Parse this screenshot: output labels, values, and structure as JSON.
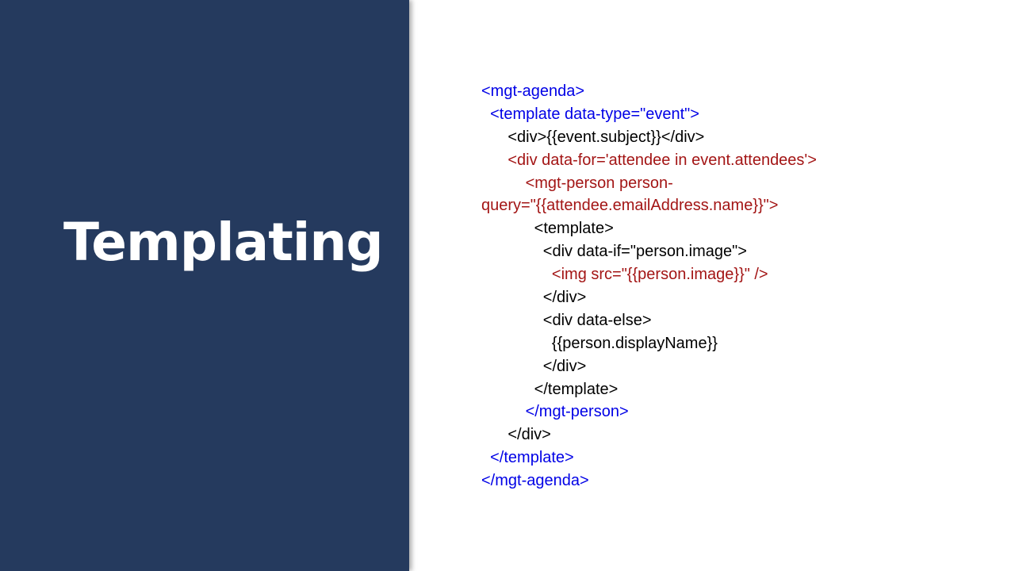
{
  "slide": {
    "title": "Templating",
    "colors": {
      "panel_background": "#253a5e",
      "title_text": "#ffffff",
      "code_blue": "#0000e6",
      "code_red": "#a31515",
      "code_black": "#000000"
    },
    "code_lines": [
      {
        "text": "<mgt-agenda>",
        "color": "blue"
      },
      {
        "text": "  <template data-type=\"event\">",
        "color": "blue"
      },
      {
        "text": "      <div>{{event.subject}}</div>",
        "color": "black"
      },
      {
        "text": "      <div data-for='attendee in event.attendees'>",
        "color": "red"
      },
      {
        "text": "          <mgt-person person-",
        "color": "red"
      },
      {
        "text": "query=\"{{attendee.emailAddress.name}}\">",
        "color": "red"
      },
      {
        "text": "            <template>",
        "color": "black"
      },
      {
        "text": "              <div data-if=\"person.image\">",
        "color": "black"
      },
      {
        "text": "                <img src=\"{{person.image}}\" />",
        "color": "red"
      },
      {
        "text": "              </div>",
        "color": "black"
      },
      {
        "text": "              <div data-else>",
        "color": "black"
      },
      {
        "text": "                {{person.displayName}}",
        "color": "black"
      },
      {
        "text": "              </div>",
        "color": "black"
      },
      {
        "text": "            </template>",
        "color": "black"
      },
      {
        "text": "          </mgt-person>",
        "color": "blue"
      },
      {
        "text": "      </div>",
        "color": "black"
      },
      {
        "text": "  </template>",
        "color": "blue"
      },
      {
        "text": "</mgt-agenda>",
        "color": "blue"
      }
    ]
  }
}
